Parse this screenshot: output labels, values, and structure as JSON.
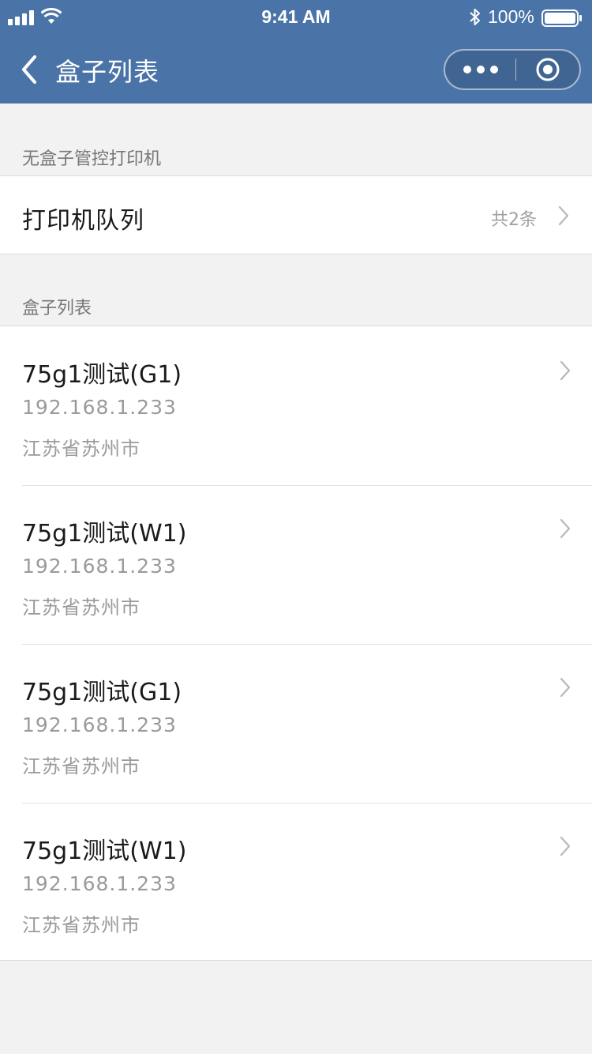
{
  "status_bar": {
    "time": "9:41 AM",
    "battery": "100%"
  },
  "nav": {
    "title": "盒子列表"
  },
  "printer_section": {
    "header": "无盒子管控打印机",
    "queue_label": "打印机队列",
    "queue_count": "共2条"
  },
  "box_section": {
    "header": "盒子列表",
    "items": [
      {
        "name": "75g1测试(G1)",
        "ip": "192.168.1.233",
        "location": "江苏省苏州市"
      },
      {
        "name": "75g1测试(W1)",
        "ip": "192.168.1.233",
        "location": "江苏省苏州市"
      },
      {
        "name": "75g1测试(G1)",
        "ip": "192.168.1.233",
        "location": "江苏省苏州市"
      },
      {
        "name": "75g1测试(W1)",
        "ip": "192.168.1.233",
        "location": "江苏省苏州市"
      }
    ]
  },
  "colors": {
    "header_bg": "#4a74a8",
    "page_bg": "#f2f2f2"
  }
}
